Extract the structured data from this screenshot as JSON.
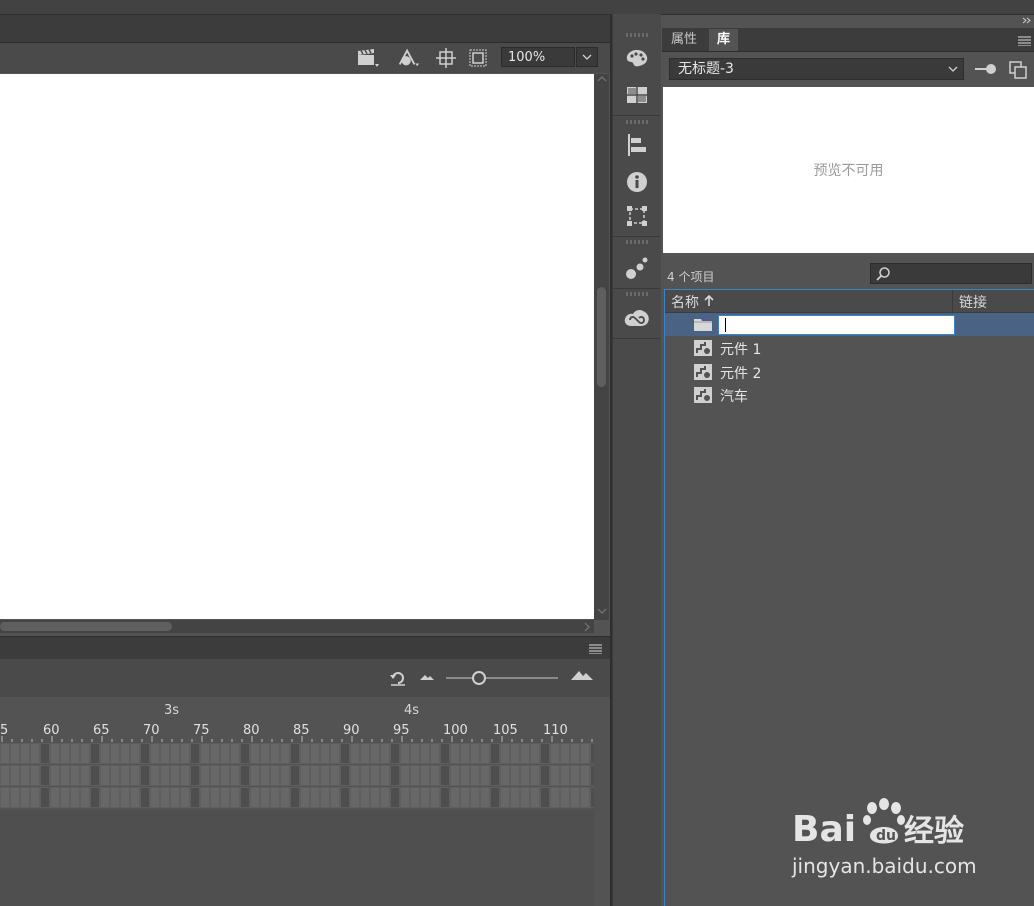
{
  "stage": {
    "zoom": "100%"
  },
  "timeline": {
    "ruler_labels": [
      "5",
      "60",
      "65",
      "70",
      "75",
      "80",
      "85",
      "90",
      "95",
      "100",
      "105",
      "110"
    ],
    "second_markers": [
      "3s",
      "4s"
    ]
  },
  "library": {
    "tabs": [
      "属性",
      "库"
    ],
    "active_tab": "库",
    "document": "无标题-3",
    "preview_text": "预览不可用",
    "item_count": "4 个项目",
    "columns": {
      "name": "名称",
      "link": "链接"
    },
    "items": [
      {
        "label": "",
        "icon": "folder-icon",
        "editing": true
      },
      {
        "label": "元件 1",
        "icon": "movieclip-symbol-icon"
      },
      {
        "label": "元件 2",
        "icon": "movieclip-symbol-icon"
      },
      {
        "label": "汽车",
        "icon": "movieclip-symbol-icon"
      }
    ]
  },
  "watermark": {
    "logo": "Bai du 经验",
    "url": "jingyan.baidu.com"
  },
  "colors": {
    "panel_bg": "#535353",
    "selection": "#4a6283",
    "accent_border": "#3a84c8"
  }
}
